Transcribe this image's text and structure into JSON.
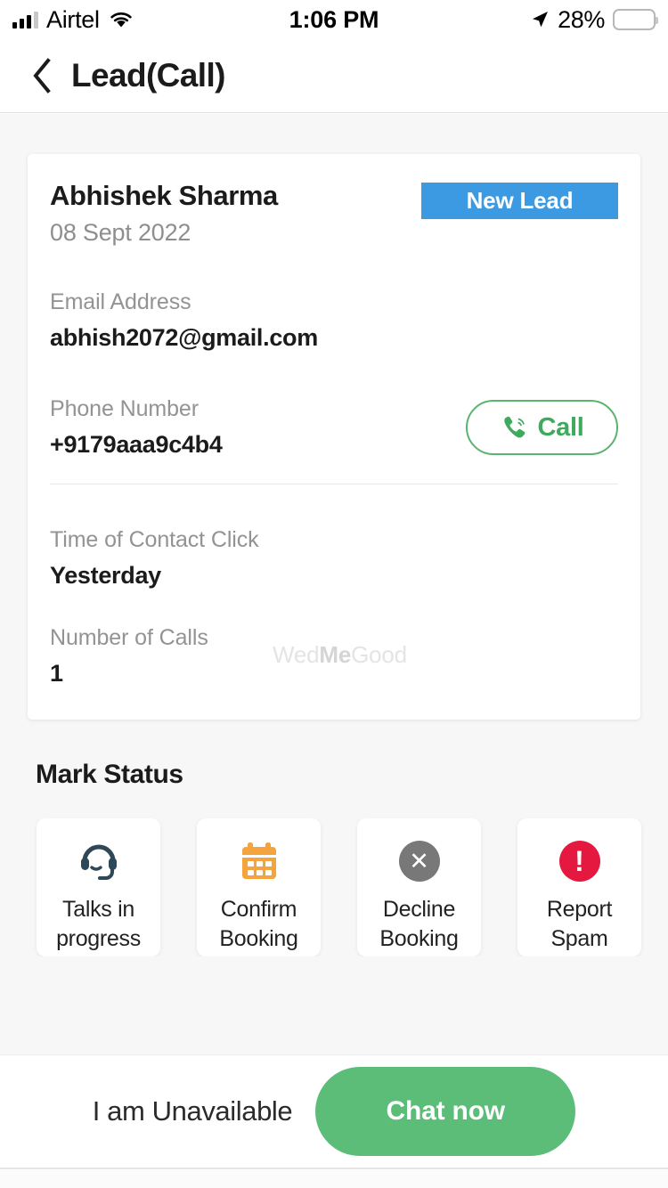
{
  "status_bar": {
    "carrier": "Airtel",
    "wifi_icon": "wifi-icon",
    "signal_icon": "cellular-signal-icon",
    "time": "1:06 PM",
    "location_icon": "location-arrow-icon",
    "battery_percent": "28%",
    "battery_icon": "battery-low-power-icon",
    "battery_level": 28,
    "battery_color": "#f6c215"
  },
  "header": {
    "back_icon": "back-chevron-icon",
    "title": "Lead(Call)"
  },
  "lead": {
    "name": "Abhishek Sharma",
    "date": "08 Sept 2022",
    "status_badge": "New Lead",
    "status_badge_color": "#3b9ae1",
    "email_label": "Email Address",
    "email_value": "abhish2072@gmail.com",
    "phone_label": "Phone Number",
    "phone_value": "+9179aaa9c4b4",
    "call_button": "Call",
    "call_icon": "phone-call-icon",
    "call_color": "#3faa5e",
    "contact_time_label": "Time of Contact Click",
    "contact_time_value": "Yesterday",
    "calls_label": "Number of Calls",
    "calls_value": "1",
    "watermark_prefix": "Wed",
    "watermark_bold": "Me",
    "watermark_suffix": "Good"
  },
  "mark_status": {
    "title": "Mark Status",
    "options": [
      {
        "label": "Talks in progress",
        "icon": "headset-icon",
        "color": "#2f4858"
      },
      {
        "label": "Confirm Booking",
        "icon": "calendar-icon",
        "color": "#f5a33c"
      },
      {
        "label": "Decline Booking",
        "icon": "cancel-circle-icon",
        "color": "#787878"
      },
      {
        "label": "Report Spam",
        "icon": "alert-circle-icon",
        "color": "#e5193f"
      }
    ]
  },
  "bottom_bar": {
    "unavailable_label": "I am Unavailable",
    "chat_label": "Chat now",
    "chat_color": "#5cbd79"
  }
}
